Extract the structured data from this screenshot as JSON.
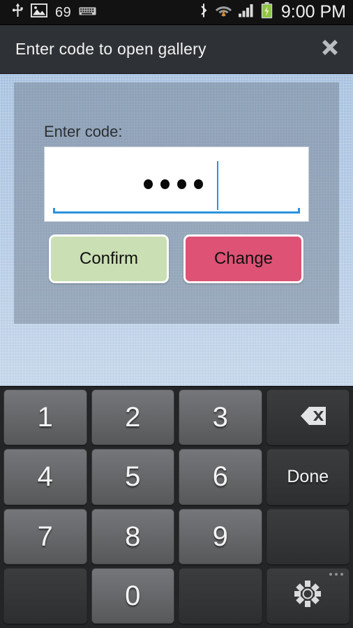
{
  "status_bar": {
    "left_icons": [
      "usb-icon",
      "gallery-image-icon",
      "keyboard-icon"
    ],
    "notification_count": "69",
    "right_icons": [
      "bluetooth-icon",
      "wifi-icon",
      "signal-icon",
      "battery-charging-icon"
    ],
    "clock": "9:00 PM"
  },
  "title_bar": {
    "title": "Enter code to open gallery",
    "close_icon": "close-icon"
  },
  "dialog": {
    "label": "Enter code:",
    "input": {
      "value": "••••",
      "masked_char_count": 4,
      "placeholder": "",
      "cursor_visible": true
    },
    "buttons": {
      "confirm": "Confirm",
      "change": "Change"
    }
  },
  "keyboard": {
    "rows": [
      [
        {
          "label": "1",
          "type": "num",
          "name": "key-1"
        },
        {
          "label": "2",
          "type": "num",
          "name": "key-2"
        },
        {
          "label": "3",
          "type": "num",
          "name": "key-3"
        },
        {
          "label": "",
          "type": "fn",
          "name": "key-backspace",
          "icon": "backspace-icon"
        }
      ],
      [
        {
          "label": "4",
          "type": "num",
          "name": "key-4"
        },
        {
          "label": "5",
          "type": "num",
          "name": "key-5"
        },
        {
          "label": "6",
          "type": "num",
          "name": "key-6"
        },
        {
          "label": "Done",
          "type": "fn",
          "name": "key-done"
        }
      ],
      [
        {
          "label": "7",
          "type": "num",
          "name": "key-7"
        },
        {
          "label": "8",
          "type": "num",
          "name": "key-8"
        },
        {
          "label": "9",
          "type": "num",
          "name": "key-9"
        },
        {
          "label": "",
          "type": "blank",
          "name": "key-blank-1"
        }
      ],
      [
        {
          "label": "",
          "type": "blank",
          "name": "key-blank-2"
        },
        {
          "label": "0",
          "type": "num",
          "name": "key-0"
        },
        {
          "label": "",
          "type": "blank",
          "name": "key-blank-3"
        },
        {
          "label": "",
          "type": "fn",
          "name": "key-settings",
          "icon": "gear-icon"
        }
      ]
    ]
  },
  "colors": {
    "confirm_button": "#cadfb4",
    "change_button": "#dd5275",
    "accent_underline": "#2c92df",
    "title_bar": "#2e3135",
    "keyboard_bg": "#232527",
    "battery_green": "#8cc63f"
  }
}
